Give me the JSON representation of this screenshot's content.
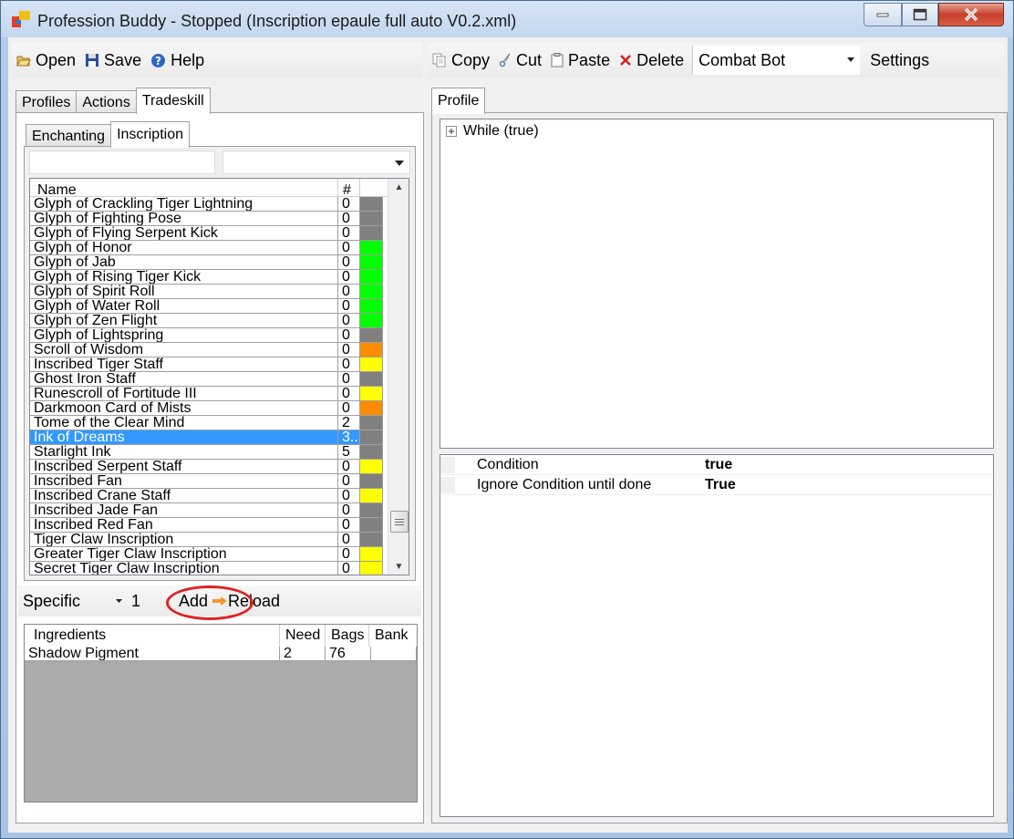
{
  "window": {
    "title": "Profession Buddy - Stopped (Inscription epaule full auto V0.2.xml)"
  },
  "toolbar": {
    "open_label": "Open",
    "save_label": "Save",
    "help_label": "Help",
    "copy_label": "Copy",
    "cut_label": "Cut",
    "paste_label": "Paste",
    "delete_label": "Delete",
    "bot_select": "Combat Bot",
    "settings_label": "Settings"
  },
  "left_tabs": [
    "Profiles",
    "Actions",
    "Tradeskill"
  ],
  "left_active_tab": "Tradeskill",
  "profession_tabs": [
    "Enchanting",
    "Inscription"
  ],
  "profession_active_tab": "Inscription",
  "recipe_grid": {
    "headers": {
      "name": "Name",
      "qty": "#"
    },
    "rows": [
      {
        "name": "Glyph of Crackling Tiger Lightning",
        "qty": "0",
        "color": "#808080"
      },
      {
        "name": "Glyph of Fighting Pose",
        "qty": "0",
        "color": "#808080"
      },
      {
        "name": "Glyph of Flying Serpent Kick",
        "qty": "0",
        "color": "#808080"
      },
      {
        "name": "Glyph of Honor",
        "qty": "0",
        "color": "#00ff00"
      },
      {
        "name": "Glyph of Jab",
        "qty": "0",
        "color": "#00ff00"
      },
      {
        "name": "Glyph of Rising Tiger Kick",
        "qty": "0",
        "color": "#00ff00"
      },
      {
        "name": "Glyph of Spirit Roll",
        "qty": "0",
        "color": "#00ff00"
      },
      {
        "name": "Glyph of Water Roll",
        "qty": "0",
        "color": "#00ff00"
      },
      {
        "name": "Glyph of Zen Flight",
        "qty": "0",
        "color": "#00ff00"
      },
      {
        "name": "Glyph of Lightspring",
        "qty": "0",
        "color": "#808080"
      },
      {
        "name": "Scroll of Wisdom",
        "qty": "0",
        "color": "#ff8c00"
      },
      {
        "name": "Inscribed Tiger Staff",
        "qty": "0",
        "color": "#ffff00"
      },
      {
        "name": "Ghost Iron Staff",
        "qty": "0",
        "color": "#808080"
      },
      {
        "name": "Runescroll of Fortitude III",
        "qty": "0",
        "color": "#ffff00"
      },
      {
        "name": "Darkmoon Card of Mists",
        "qty": "0",
        "color": "#ff8c00"
      },
      {
        "name": "Tome of the Clear Mind",
        "qty": "2",
        "color": "#808080"
      },
      {
        "name": "Ink of Dreams",
        "qty": "3..",
        "color": "#808080",
        "selected": true
      },
      {
        "name": "Starlight Ink",
        "qty": "5",
        "color": "#808080"
      },
      {
        "name": "Inscribed Serpent Staff",
        "qty": "0",
        "color": "#ffff00"
      },
      {
        "name": "Inscribed Fan",
        "qty": "0",
        "color": "#808080"
      },
      {
        "name": "Inscribed Crane Staff",
        "qty": "0",
        "color": "#ffff00"
      },
      {
        "name": "Inscribed Jade Fan",
        "qty": "0",
        "color": "#808080"
      },
      {
        "name": "Inscribed Red Fan",
        "qty": "0",
        "color": "#808080"
      },
      {
        "name": "Tiger Claw Inscription",
        "qty": "0",
        "color": "#808080"
      },
      {
        "name": "Greater Tiger Claw Inscription",
        "qty": "0",
        "color": "#ffff00"
      },
      {
        "name": "Secret Tiger Claw Inscription",
        "qty": "0",
        "color": "#ffff00"
      }
    ]
  },
  "add_bar": {
    "mode": "Specific",
    "count": "1",
    "add_label": "Add",
    "reload_label": "Reload"
  },
  "ingredients": {
    "headers": [
      "Ingredients",
      "Need",
      "Bags",
      "Bank"
    ],
    "rows": [
      {
        "name": "Shadow Pigment",
        "need": "2",
        "bags": "76",
        "bank": ""
      }
    ]
  },
  "profile_tab": "Profile",
  "profile_tree": {
    "node": "While (true)"
  },
  "properties": [
    {
      "name": "Condition",
      "value": "true"
    },
    {
      "name": "Ignore Condition until done",
      "value": "True"
    }
  ],
  "colors": {
    "selection": "#3399ff",
    "annotation": "#dd2222"
  }
}
